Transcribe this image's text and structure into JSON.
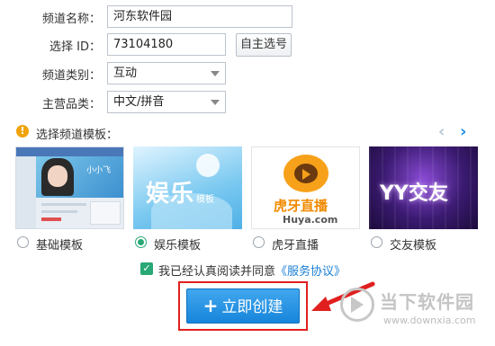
{
  "form": {
    "channel_name_label": "频道名称：",
    "channel_name_value": "河东软件园",
    "select_id_label": "选择 ID：",
    "select_id_value": "73104180",
    "self_pick_button": "自主选号",
    "category_label": "频道类别：",
    "category_value": "互动",
    "main_category_label": "主营品类：",
    "main_category_value": "中文/拼音"
  },
  "templates": {
    "title": "选择频道模板：",
    "items": [
      {
        "label": "基础模板",
        "selected": false,
        "thumb_text": "小小飞"
      },
      {
        "label": "娱乐模板",
        "selected": true,
        "thumb_text": "娱乐",
        "thumb_sub": "模板"
      },
      {
        "label": "虎牙直播",
        "selected": false,
        "thumb_text": "虎牙直播",
        "thumb_sub": "Huya.com"
      },
      {
        "label": "交友模板",
        "selected": false,
        "thumb_text": "YY交友"
      }
    ]
  },
  "agreement": {
    "checked": true,
    "text": "我已经认真阅读并同意",
    "link": "《服务协议》"
  },
  "create_button": {
    "plus": "+",
    "label": "立即创建"
  },
  "watermark": {
    "name": "当下软件园",
    "url": "www.downxia.com"
  },
  "colors": {
    "primary_blue": "#1f8fe3",
    "highlight_red": "#e0201f",
    "accent_green": "#2aa876",
    "warning_orange": "#f0a30a"
  }
}
